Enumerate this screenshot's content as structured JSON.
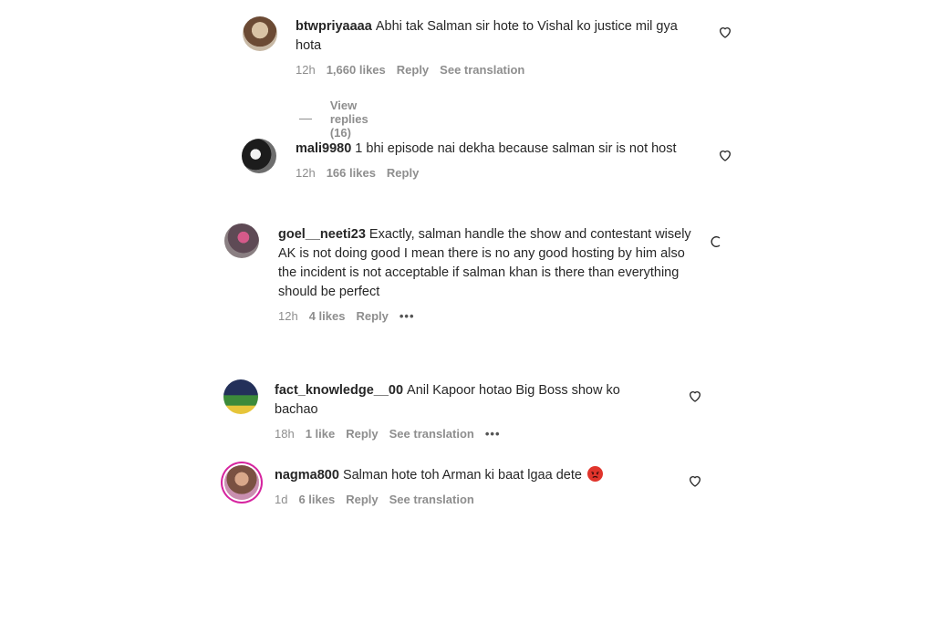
{
  "comments": [
    {
      "username": "btwpriyaaaa",
      "text": "Abhi tak Salman sir hote to Vishal ko justice mil gya hota",
      "time": "12h",
      "likes": "1,660 likes",
      "reply": "Reply",
      "translation": "See translation",
      "view_replies": "View replies (16)"
    },
    {
      "username": "mali9980",
      "text": "1 bhi episode nai dekha because salman sir is not host",
      "time": "12h",
      "likes": "166 likes",
      "reply": "Reply"
    },
    {
      "username": "goel__neeti23",
      "text": "Exactly, salman handle the show and contestant wisely AK is not doing good I mean there is no any good hosting by him also the incident is not acceptable if salman khan is there than everything should be perfect",
      "time": "12h",
      "likes": "4 likes",
      "reply": "Reply",
      "more": "•••"
    },
    {
      "username": "fact_knowledge__00",
      "text": "Anil Kapoor hotao Big Boss show ko bachao",
      "time": "18h",
      "likes": "1 like",
      "reply": "Reply",
      "translation": "See translation",
      "more": "•••"
    },
    {
      "username": "nagma800",
      "text": "Salman hote toh Arman ki baat lgaa dete",
      "time": "1d",
      "likes": "6 likes",
      "reply": "Reply",
      "translation": "See translation",
      "emoji": "angry-face"
    }
  ],
  "icons": {
    "like": "heart-icon",
    "loading": "spinner-icon"
  },
  "colors": {
    "text": "#262626",
    "meta": "#8e8e8e",
    "story_ring": "#d6249f"
  }
}
